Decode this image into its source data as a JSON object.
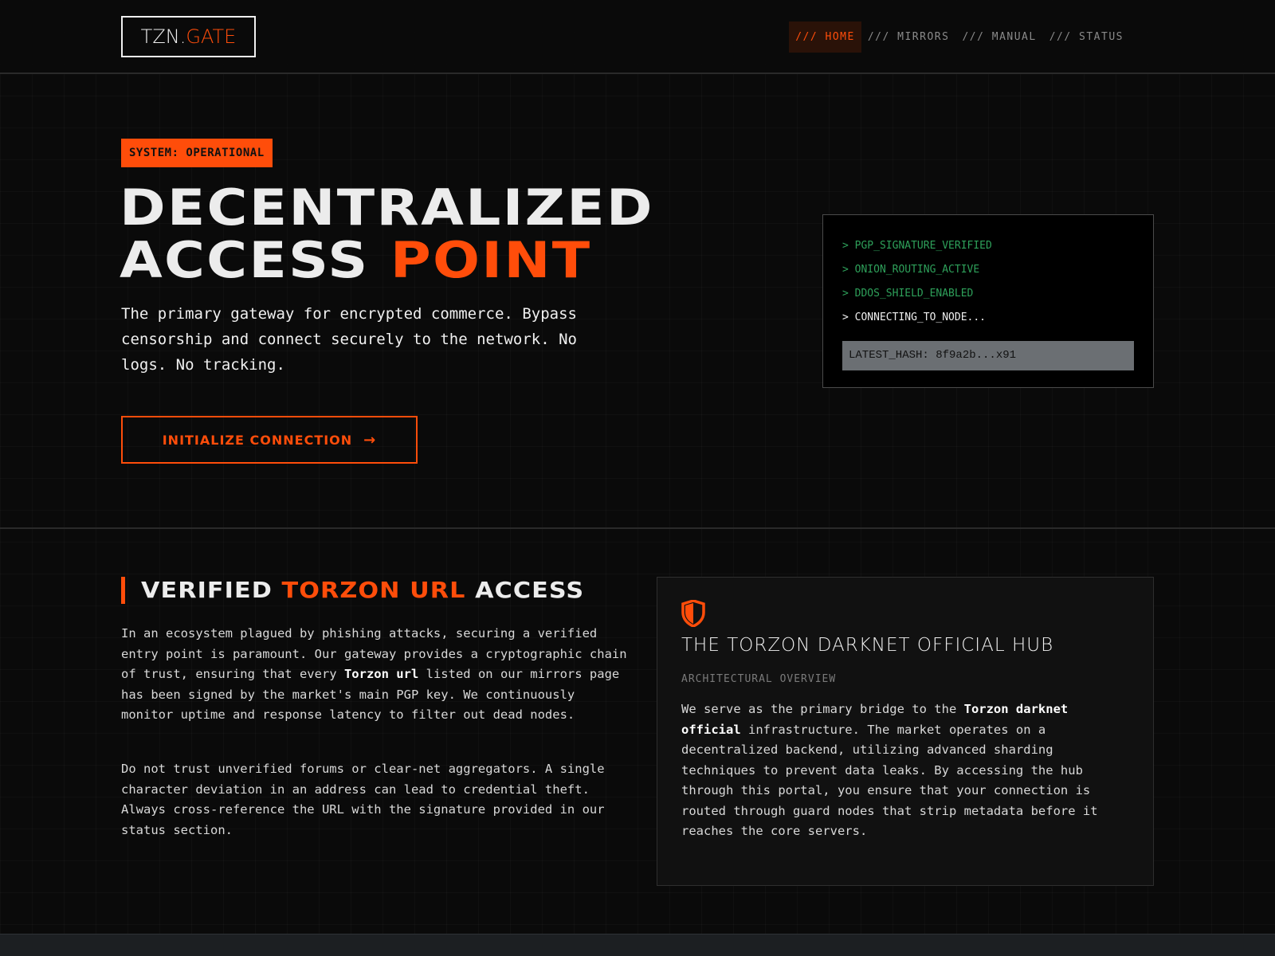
{
  "header": {
    "logo": {
      "part1": "TZN.",
      "part2": "GATE"
    },
    "nav": [
      {
        "label": "/// HOME",
        "active": true
      },
      {
        "label": "/// MIRRORS",
        "active": false
      },
      {
        "label": "/// MANUAL",
        "active": false
      },
      {
        "label": "/// STATUS",
        "active": false
      }
    ]
  },
  "hero": {
    "badge": "SYSTEM: OPERATIONAL",
    "title_line1": "DECENTRALIZED",
    "title_line2_a": "ACCESS ",
    "title_line2_b": "POINT",
    "description": "The primary gateway for encrypted commerce. Bypass censorship and connect securely to the network. No logs. No tracking.",
    "cta_label": "INITIALIZE CONNECTION",
    "cta_icon": "arrow-right-icon"
  },
  "terminal": {
    "lines": [
      "> PGP_SIGNATURE_VERIFIED",
      "> ONION_ROUTING_ACTIVE",
      "> DDOS_SHIELD_ENABLED",
      "> CONNECTING_TO_NODE..."
    ],
    "hash": "LATEST_HASH: 8f9a2b...x91"
  },
  "section": {
    "title_a": "VERIFIED ",
    "title_b": "TORZON URL",
    "title_c": " ACCESS",
    "para1_a": "In an ecosystem plagued by phishing attacks, securing a verified entry point is paramount. Our gateway provides a cryptographic chain of trust, ensuring that every ",
    "para1_bold": "Torzon url",
    "para1_b": " listed on our mirrors page has been signed by the market's main PGP key. We continuously monitor uptime and response latency to filter out dead nodes.",
    "para2": "Do not trust unverified forums or clear-net aggregators. A single character deviation in an address can lead to credential theft. Always cross-reference the URL with the signature provided in our status section."
  },
  "card": {
    "icon": "shield-icon",
    "title": "THE TORZON DARKNET OFFICIAL HUB",
    "subtitle": "ARCHITECTURAL OVERVIEW",
    "body_a": "We serve as the primary bridge to the ",
    "body_bold": "Torzon darknet official",
    "body_b": " infrastructure. The market operates on a decentralized backend, utilizing advanced sharding techniques to prevent data leaks. By accessing the hub through this portal, you ensure that your connection is routed through guard nodes that strip metadata before it reaches the core servers."
  },
  "colors": {
    "accent": "#ff4d0a",
    "terminal_green": "#2ea05a",
    "background": "#0a0a0a"
  }
}
